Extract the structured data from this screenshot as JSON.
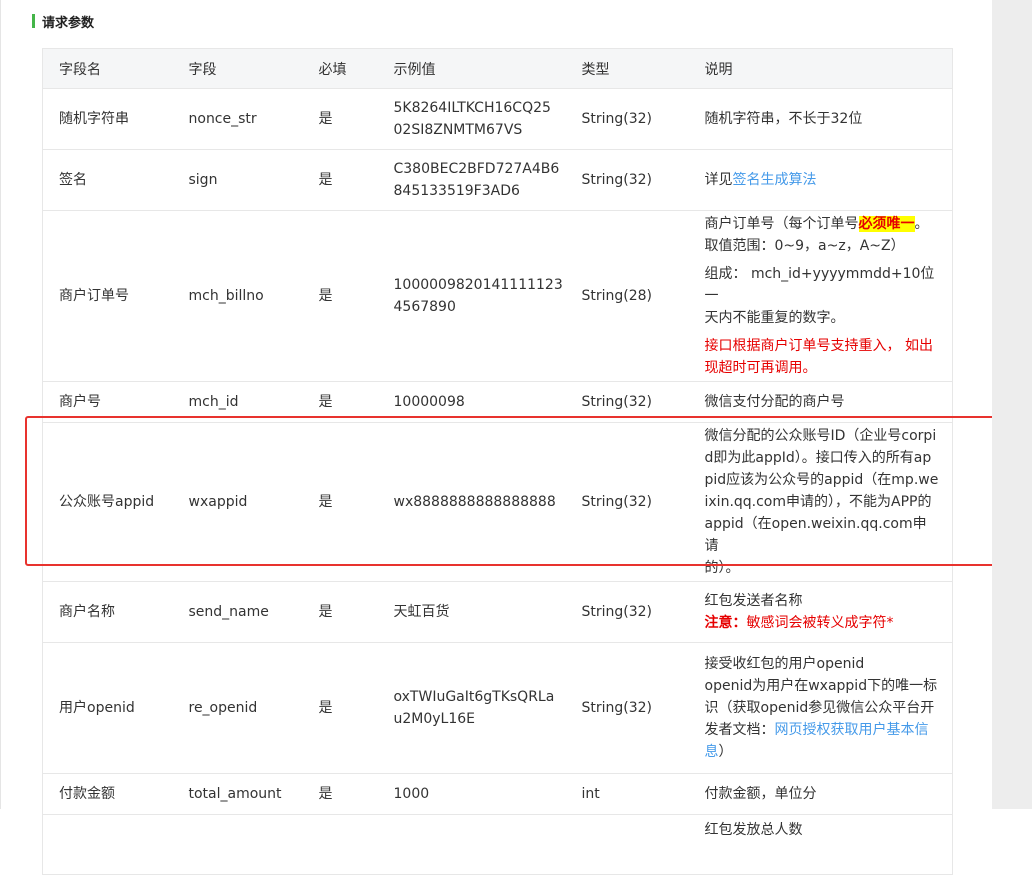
{
  "section": {
    "title": "请求参数"
  },
  "table": {
    "headers": [
      "字段名",
      "字段",
      "必填",
      "示例值",
      "类型",
      "说明"
    ],
    "rows": [
      {
        "name": "随机字符串",
        "field": "nonce_str",
        "required": "是",
        "example": [
          "5K8264ILTKCH16CQ25",
          "02SI8ZNMTM67VS"
        ],
        "type": "String(32)",
        "desc": {
          "line1": "随机字符串，不长于32位"
        }
      },
      {
        "name": "签名",
        "field": "sign",
        "required": "是",
        "example": [
          "C380BEC2BFD727A4B6",
          "845133519F3AD6"
        ],
        "type": "String(32)",
        "desc": {
          "prefix": "详见",
          "link": "签名生成算法"
        }
      },
      {
        "name": "商户订单号",
        "field": "mch_billno",
        "required": "是",
        "example": [
          "1000009820141111123",
          "4567890"
        ],
        "type": "String(28)",
        "desc": {
          "line1a": "商户订单号（每个订单号",
          "line1_highlight": "必须唯一",
          "line1b": "。",
          "line2": "取值范围：0~9，a~z，A~Z）",
          "line3": "组成： mch_id+yyyymmdd+10位一",
          "line4": "天内不能重复的数字。",
          "line5": "接口根据商户订单号支持重入， 如出",
          "line6": "现超时可再调用。"
        }
      },
      {
        "name": "商户号",
        "field": "mch_id",
        "required": "是",
        "example": [
          "10000098"
        ],
        "type": "String(32)",
        "desc": {
          "line1": "微信支付分配的商户号"
        }
      },
      {
        "name": "公众账号appid",
        "field": "wxappid",
        "required": "是",
        "example": [
          "wx8888888888888888"
        ],
        "type": "String(32)",
        "desc": {
          "line1": "微信分配的公众账号ID（企业号corpi",
          "line2": "d即为此appId）。接口传入的所有ap",
          "line3": "pid应该为公众号的appid（在mp.we",
          "line4": "ixin.qq.com申请的），不能为APP的",
          "line5": "appid（在open.weixin.qq.com申请",
          "line6": "的）。"
        }
      },
      {
        "name": "商户名称",
        "field": "send_name",
        "required": "是",
        "example": [
          "天虹百货"
        ],
        "type": "String(32)",
        "desc": {
          "line1": "红包发送者名称",
          "note_label": "注意：",
          "note_text": "敏感词会被转义成字符*"
        }
      },
      {
        "name": "用户openid",
        "field": "re_openid",
        "required": "是",
        "example": [
          "oxTWIuGaIt6gTKsQRLa",
          "u2M0yL16E"
        ],
        "type": "String(32)",
        "desc": {
          "line1": "接受收红包的用户openid",
          "line2": "openid为用户在wxappid下的唯一标",
          "line3": "识（获取openid参见微信公众平台开",
          "line4a": "发者文档：",
          "line4_link": "网页授权获取用户基本信",
          "line5_link": "息",
          "line5b": "）"
        }
      },
      {
        "name": "付款金额",
        "field": "total_amount",
        "required": "是",
        "example": [
          "1000"
        ],
        "type": "int",
        "desc": {
          "line1": "付款金额，单位分"
        }
      },
      {
        "desc": {
          "line1": "红包发放总人数"
        }
      }
    ]
  },
  "colors": {
    "accent_green": "#44b549",
    "highlight_red": "#e8332e",
    "link_blue": "#459ae9",
    "warning_red": "#e60000"
  }
}
